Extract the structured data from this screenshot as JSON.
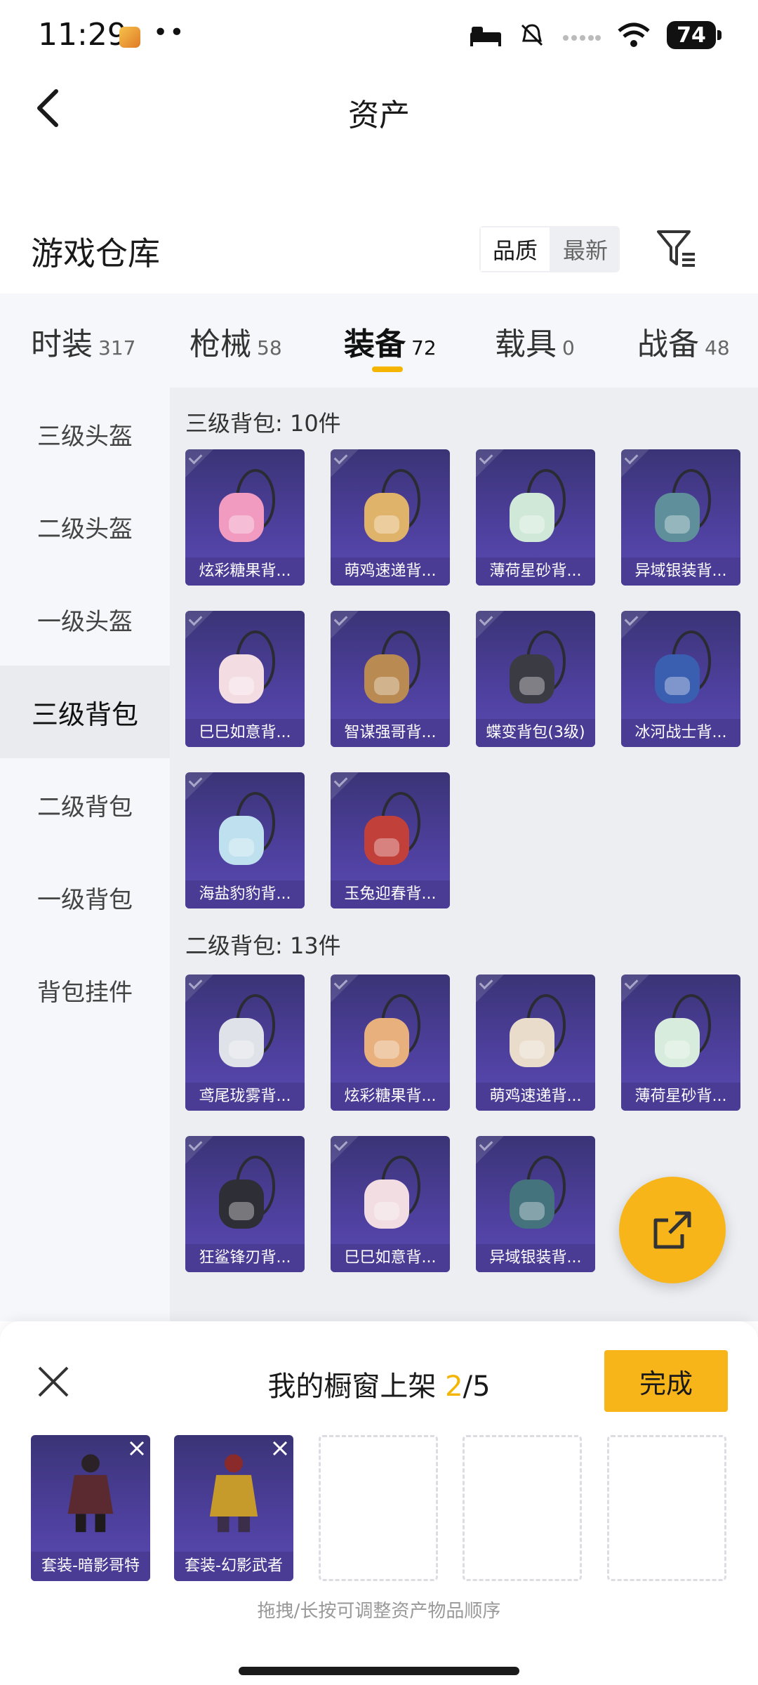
{
  "status_bar": {
    "time": "11:29",
    "dots": "••",
    "battery": "74"
  },
  "nav": {
    "title": "资产"
  },
  "warehouse": {
    "title": "游戏仓库",
    "sort_options": [
      "品质",
      "最新"
    ]
  },
  "tabs": [
    {
      "label": "时装",
      "count": "317"
    },
    {
      "label": "枪械",
      "count": "58"
    },
    {
      "label": "装备",
      "count": "72"
    },
    {
      "label": "载具",
      "count": "0"
    },
    {
      "label": "战备",
      "count": "48"
    }
  ],
  "sidebar": {
    "items": [
      "三级头盔",
      "二级头盔",
      "一级头盔",
      "三级背包",
      "二级背包",
      "一级背包",
      "背包挂件"
    ]
  },
  "sections": [
    {
      "title": "三级背包: 10件",
      "items": [
        {
          "label": "炫彩糖果背...",
          "color": "#f29bc0"
        },
        {
          "label": "萌鸡速递背...",
          "color": "#e0b36a"
        },
        {
          "label": "薄荷星砂背...",
          "color": "#cfe8d8"
        },
        {
          "label": "异域银装背...",
          "color": "#5f8f9a"
        },
        {
          "label": "巳巳如意背...",
          "color": "#f3dde3"
        },
        {
          "label": "智谋强哥背...",
          "color": "#b98a52"
        },
        {
          "label": "蝶变背包(3级)",
          "color": "#3b3b44"
        },
        {
          "label": "冰河战士背...",
          "color": "#3a5fb0"
        },
        {
          "label": "海盐豹豹背...",
          "color": "#bfe0ef"
        },
        {
          "label": "玉兔迎春背...",
          "color": "#c2403a"
        }
      ]
    },
    {
      "title": "二级背包: 13件",
      "items": [
        {
          "label": "鸢尾珑雾背...",
          "color": "#dfe2e8"
        },
        {
          "label": "炫彩糖果背...",
          "color": "#e7b07c"
        },
        {
          "label": "萌鸡速递背...",
          "color": "#e9dccb"
        },
        {
          "label": "薄荷星砂背...",
          "color": "#d7ecdc"
        },
        {
          "label": "狂鲨锋刃背...",
          "color": "#2e2e36"
        },
        {
          "label": "巳巳如意背...",
          "color": "#f2dde2"
        },
        {
          "label": "异域银装背...",
          "color": "#44727d"
        }
      ]
    }
  ],
  "showcase": {
    "title": "我的橱窗上架",
    "current": "2",
    "total": "/5",
    "done_label": "完成",
    "slots": [
      {
        "label": "套装-暗影哥特",
        "color": "#5a2a30"
      },
      {
        "label": "套装-幻影武者",
        "color": "#c79a2c"
      }
    ],
    "hint": "拖拽/长按可调整资产物品顺序"
  }
}
